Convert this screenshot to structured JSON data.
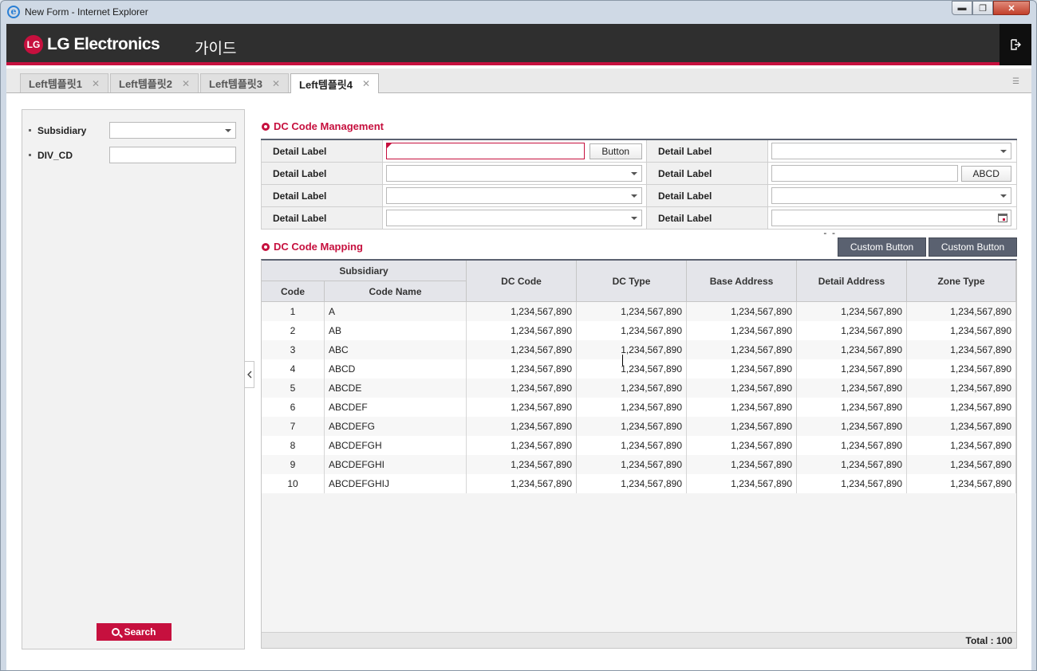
{
  "window": {
    "title": "New Form - Internet Explorer",
    "min": "▬",
    "max": "❐",
    "close": "✕"
  },
  "header": {
    "brand": "LG Electronics",
    "title": "가이드"
  },
  "tabs": [
    {
      "label": "Left템플릿1",
      "close": "✕"
    },
    {
      "label": "Left템플릿2",
      "close": "✕"
    },
    {
      "label": "Left템플릿3",
      "close": "✕"
    },
    {
      "label": "Left템플릿4",
      "close": "✕"
    }
  ],
  "search_panel": {
    "fields": [
      {
        "label": "Subsidiary",
        "value": ""
      },
      {
        "label": "DIV_CD",
        "value": ""
      }
    ],
    "search_label": "Search"
  },
  "management": {
    "title": "DC Code Management",
    "rows": [
      {
        "left_label": "Detail Label",
        "left_button": "Button",
        "right_label": "Detail Label"
      },
      {
        "left_label": "Detail Label",
        "right_label": "Detail Label",
        "right_button": "ABCD"
      },
      {
        "left_label": "Detail Label",
        "right_label": "Detail Label"
      },
      {
        "left_label": "Detail Label",
        "right_label": "Detail Label",
        "right_date": "  -  -"
      }
    ]
  },
  "mapping": {
    "title": "DC Code Mapping",
    "buttons": [
      "Custom Button",
      "Custom Button"
    ],
    "columns": {
      "group": "Subsidiary",
      "code": "Code",
      "code_name": "Code Name",
      "dc_code": "DC Code",
      "dc_type": "DC Type",
      "base_address": "Base Address",
      "detail_address": "Detail Address",
      "zone_type": "Zone Type"
    },
    "rows": [
      {
        "code": "1",
        "name": "A",
        "v": "1,234,567,890"
      },
      {
        "code": "2",
        "name": "AB",
        "v": "1,234,567,890"
      },
      {
        "code": "3",
        "name": "ABC",
        "v": "1,234,567,890"
      },
      {
        "code": "4",
        "name": "ABCD",
        "v": "1,234,567,890"
      },
      {
        "code": "5",
        "name": "ABCDE",
        "v": "1,234,567,890"
      },
      {
        "code": "6",
        "name": "ABCDEF",
        "v": "1,234,567,890"
      },
      {
        "code": "7",
        "name": "ABCDEFG",
        "v": "1,234,567,890"
      },
      {
        "code": "8",
        "name": "ABCDEFGH",
        "v": "1,234,567,890"
      },
      {
        "code": "9",
        "name": "ABCDEFGHI",
        "v": "1,234,567,890"
      },
      {
        "code": "10",
        "name": "ABCDEFGHIJ",
        "v": "1,234,567,890"
      }
    ],
    "total": "Total : 100"
  },
  "colors": {
    "brand": "#c6103e",
    "header": "#2f2f2f",
    "button_dark": "#5a6170"
  }
}
